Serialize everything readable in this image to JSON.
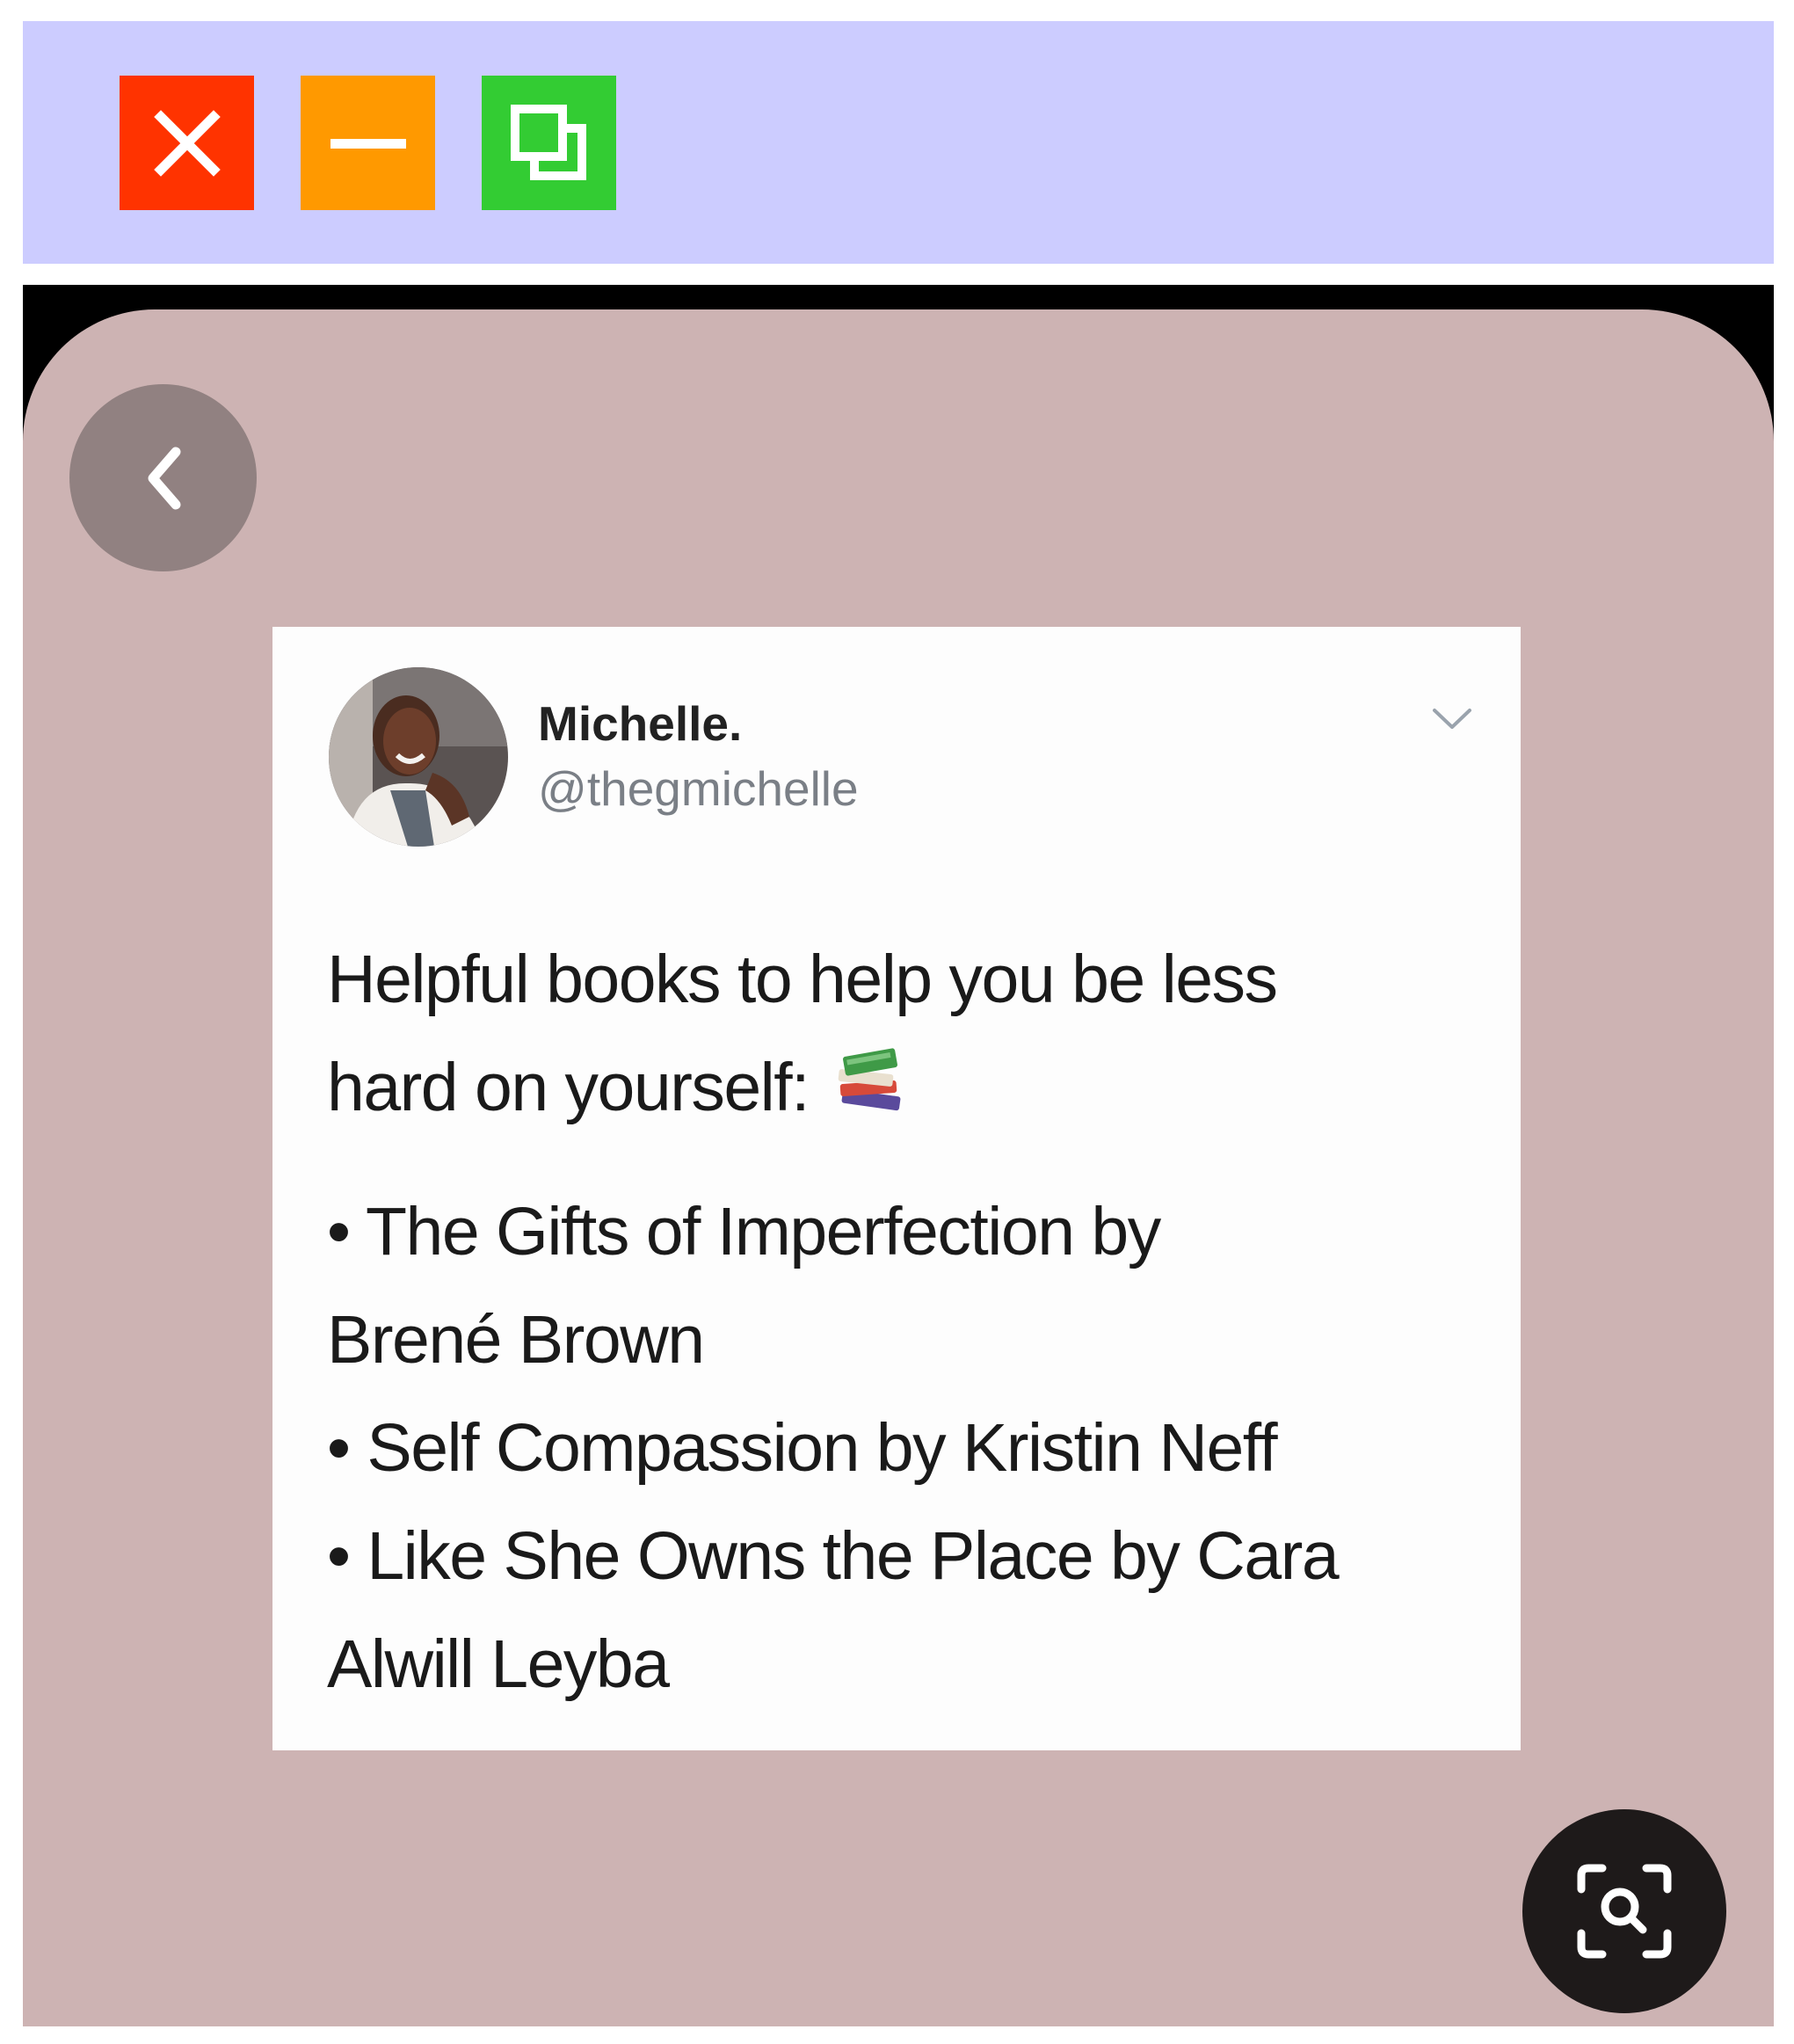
{
  "window_controls": {
    "close_icon": "close-icon",
    "minimize_icon": "minimize-icon",
    "maximize_icon": "restore-icon"
  },
  "colors": {
    "titlebar": "#ccccff",
    "close": "#ff3300",
    "minimize": "#ff9900",
    "maximize": "#33cc33",
    "screen_background": "#cdb3b3",
    "back_button": "#918181",
    "lens_button": "#1e1a1a"
  },
  "viewer": {
    "back_icon": "chevron-left-icon",
    "lens_icon": "image-search-icon"
  },
  "tweet": {
    "author_name": "Michelle.",
    "author_handle": "@thegmichelle",
    "intro_line1": "Helpful books to help you be less",
    "intro_line2": "hard on yourself:",
    "intro_emoji": "books-emoji-icon",
    "book1_line1": "• The Gifts of Imperfection by",
    "book1_line2": "Brené Brown",
    "book2": "• Self Compassion by Kristin Neff",
    "book3_line1": "• Like She Owns the Place by Cara",
    "book3_line2": "Alwill Leyba"
  }
}
